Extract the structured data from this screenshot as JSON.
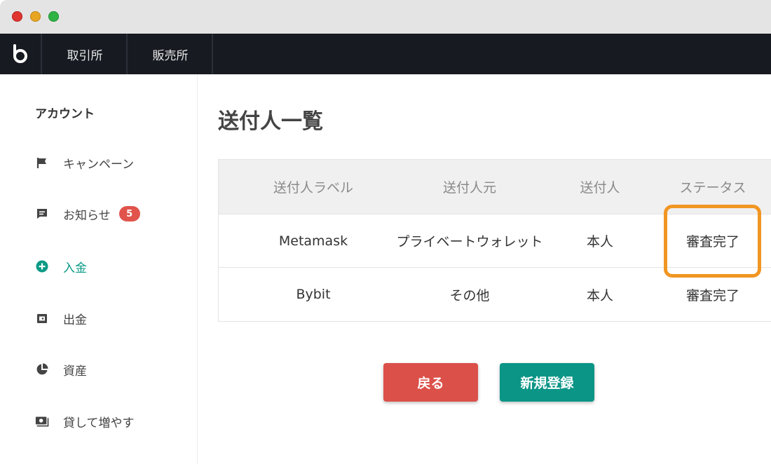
{
  "nav": {
    "logo_icon": "bybit-logo-icon",
    "items": [
      {
        "label": "取引所"
      },
      {
        "label": "販売所"
      }
    ]
  },
  "sidebar": {
    "title": "アカウント",
    "items": [
      {
        "icon": "flag-icon",
        "label": "キャンペーン"
      },
      {
        "icon": "message-icon",
        "label": "お知らせ",
        "badge": "5"
      },
      {
        "icon": "plus-circle-icon",
        "label": "入金",
        "active": true
      },
      {
        "icon": "wallet-icon",
        "label": "出金"
      },
      {
        "icon": "pie-chart-icon",
        "label": "資産"
      },
      {
        "icon": "cash-icon",
        "label": "貸して増やす"
      }
    ]
  },
  "main": {
    "title": "送付人一覧",
    "table": {
      "headers": [
        "送付人ラベル",
        "送付人元",
        "送付人",
        "ステータス"
      ],
      "rows": [
        [
          "Metamask",
          "プライベートウォレット",
          "本人",
          "審査完了"
        ],
        [
          "Bybit",
          "その他",
          "本人",
          "審査完了"
        ]
      ]
    },
    "buttons": {
      "back": "戻る",
      "register": "新規登録"
    }
  },
  "colors": {
    "accent": "#0a9b86",
    "danger": "#db5049",
    "highlight": "#f19622",
    "nav_bg": "#171a21"
  }
}
